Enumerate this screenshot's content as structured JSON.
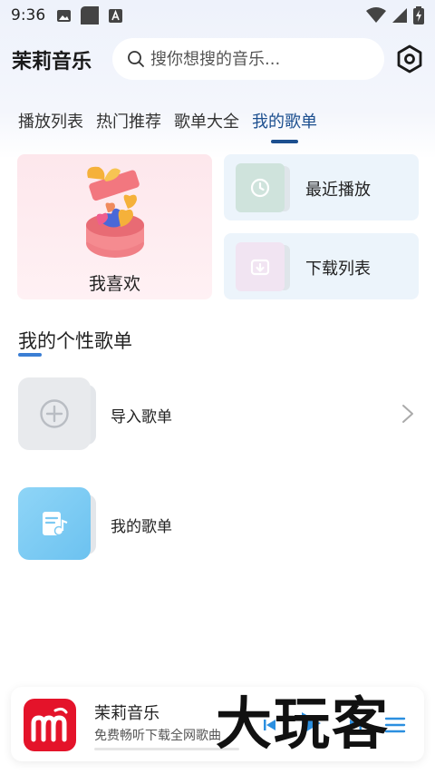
{
  "status_bar": {
    "time": "9:36"
  },
  "header": {
    "title": "茉莉音乐",
    "search_placeholder": "搜你想搜的音乐..."
  },
  "tabs": [
    {
      "label": "播放列表",
      "active": false
    },
    {
      "label": "热门推荐",
      "active": false
    },
    {
      "label": "歌单大全",
      "active": false
    },
    {
      "label": "我的歌单",
      "active": true
    }
  ],
  "cards": {
    "favorite": {
      "label": "我喜欢"
    },
    "recent": {
      "label": "最近播放",
      "icon": "clock-icon",
      "color": "#cfe3dc"
    },
    "downloads": {
      "label": "下载列表",
      "icon": "download-icon",
      "color": "#f1e4f2"
    }
  },
  "section": {
    "title": "我的个性歌单"
  },
  "playlists": [
    {
      "label": "导入歌单",
      "icon": "plus-circle-icon"
    },
    {
      "label": "我的歌单",
      "icon": "music-document-icon"
    }
  ],
  "mini_player": {
    "title": "茉莉音乐",
    "subtitle": "免费畅听下载全网歌曲",
    "accent": "#e4132a"
  },
  "watermark": {
    "text": "大玩客"
  },
  "colors": {
    "accent_blue": "#1c4f8f",
    "section_underline": "#3b7ed4",
    "favorite_bg": "#fde7ec",
    "side_card_bg": "#ecf4fb"
  }
}
